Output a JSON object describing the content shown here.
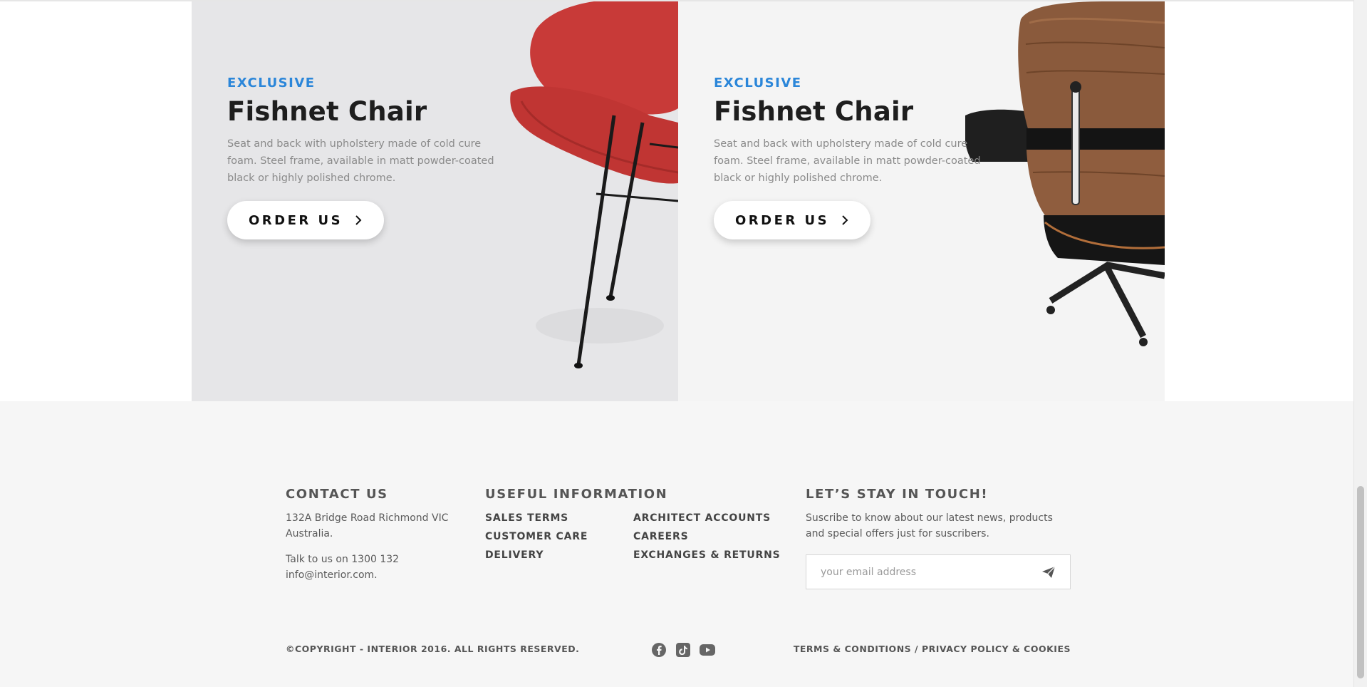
{
  "promos": [
    {
      "kicker": "EXCLUSIVE",
      "title": "Fishnet Chair",
      "description": "Seat and back with upholstery made of cold cure foam. Steel frame, available in matt powder-coated black or highly polished chrome.",
      "button_label": "ORDER US"
    },
    {
      "kicker": "EXCLUSIVE",
      "title": "Fishnet Chair",
      "description": "Seat and back with upholstery made of cold cure foam. Steel frame, available in matt powder-coated black or highly polished chrome.",
      "button_label": "ORDER US"
    }
  ],
  "footer": {
    "contact": {
      "heading": "CONTACT US",
      "address": "132A Bridge Road Richmond VIC Australia.",
      "talk": "Talk to us on 1300 132 info@interior.com."
    },
    "info": {
      "heading": "USEFUL INFORMATION",
      "links": [
        "SALES TERMS",
        "ARCHITECT ACCOUNTS",
        "CUSTOMER CARE",
        "CAREERS",
        "DELIVERY",
        "EXCHANGES & RETURNS"
      ]
    },
    "newsletter": {
      "heading": "LET’S STAY IN TOUCH!",
      "text": "Suscribe to know about our latest news, products and special offers just for suscribers.",
      "placeholder": "your email address"
    },
    "copyright": "©COPYRIGHT - INTERIOR 2016. ALL RIGHTS RESERVED.",
    "legal": {
      "terms": "TERMS & CONDITIONS",
      "separator": " / ",
      "privacy": "PRIVACY POLICY & COOKIES"
    },
    "socials": [
      "facebook-icon",
      "tiktok-icon",
      "youtube-icon"
    ]
  },
  "colors": {
    "accent": "#2b86d9",
    "footer_bg": "#f6f6f6",
    "promo_left_bg": "#e6e6e8",
    "promo_right_bg": "#f4f4f4",
    "chair_red": "#c83a38"
  }
}
